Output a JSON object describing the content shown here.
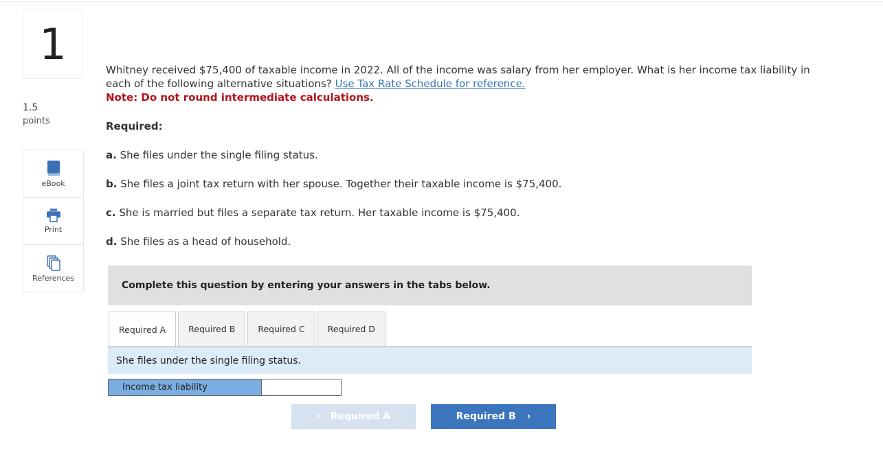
{
  "question": {
    "number": "1",
    "points_value": "1.5",
    "points_label": "points"
  },
  "tools": [
    {
      "label": "eBook",
      "icon": "book-icon"
    },
    {
      "label": "Print",
      "icon": "printer-icon"
    },
    {
      "label": "References",
      "icon": "copy-icon"
    }
  ],
  "body": {
    "intro": "Whitney received $75,400 of taxable income in 2022. All of the income was salary from her employer. What is her income tax liability in each of the following alternative situations?",
    "link": "Use Tax Rate Schedule for reference.",
    "note": "Note: Do not round intermediate calculations.",
    "required": "Required:",
    "parts": [
      {
        "letter": "a.",
        "text": "She files under the single filing status."
      },
      {
        "letter": "b.",
        "text": "She files a joint tax return with her spouse. Together their taxable income is $75,400."
      },
      {
        "letter": "c.",
        "text": "She is married but files a separate tax return. Her taxable income is $75,400."
      },
      {
        "letter": "d.",
        "text": "She files as a head of household."
      }
    ]
  },
  "banner": "Complete this question by entering your answers in the tabs below.",
  "tabs": [
    {
      "label": "Required A",
      "active": true
    },
    {
      "label": "Required B",
      "active": false
    },
    {
      "label": "Required C",
      "active": false
    },
    {
      "label": "Required D",
      "active": false
    }
  ],
  "tab_content": {
    "description": "She files under the single filing status.",
    "field_label": "Income tax liability",
    "field_value": ""
  },
  "nav": {
    "prev_label": "Required A",
    "next_label": "Required B"
  },
  "colors": {
    "accent": "#3b75bd",
    "note": "#b3141b",
    "label_bg": "#7aaee2",
    "desc_bg": "#dbebf8"
  }
}
